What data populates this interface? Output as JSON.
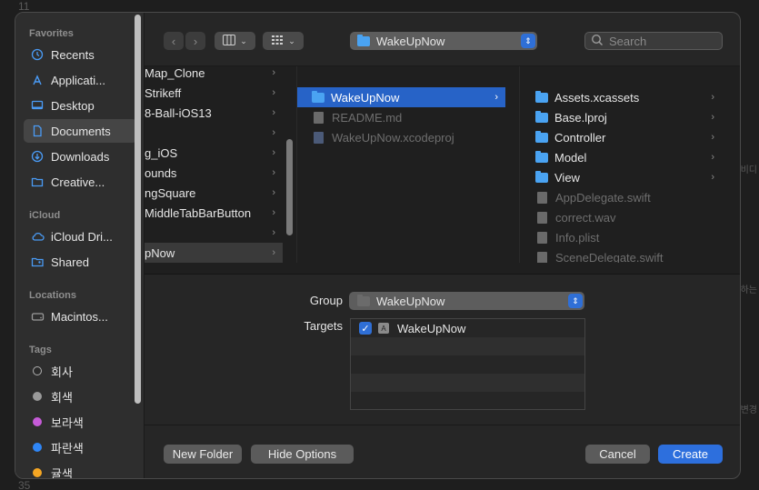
{
  "background": {
    "line_top": "11",
    "line_bottom": "35",
    "side_notes": [
      "비디",
      "하는",
      "변경"
    ]
  },
  "sidebar": {
    "sections": [
      {
        "title": "Favorites",
        "items": [
          {
            "label": "Recents",
            "icon": "clock-icon"
          },
          {
            "label": "Applicati...",
            "icon": "applications-icon"
          },
          {
            "label": "Desktop",
            "icon": "desktop-icon"
          },
          {
            "label": "Documents",
            "icon": "document-icon",
            "selected": true
          },
          {
            "label": "Downloads",
            "icon": "download-icon"
          },
          {
            "label": "Creative...",
            "icon": "folder-icon"
          }
        ]
      },
      {
        "title": "iCloud",
        "items": [
          {
            "label": "iCloud Dri...",
            "icon": "cloud-icon"
          },
          {
            "label": "Shared",
            "icon": "shared-folder-icon"
          }
        ]
      },
      {
        "title": "Locations",
        "items": [
          {
            "label": "Macintos...",
            "icon": "disk-icon"
          }
        ]
      },
      {
        "title": "Tags",
        "items": [
          {
            "label": "회사",
            "color": "#2a2a2a",
            "ring": "#b0b0b0"
          },
          {
            "label": "회색",
            "color": "#9a9a9a"
          },
          {
            "label": "보라색",
            "color": "#c65bd8"
          },
          {
            "label": "파란색",
            "color": "#2f86f6"
          },
          {
            "label": "귤색",
            "color": "#f5a623"
          }
        ]
      }
    ]
  },
  "toolbar": {
    "path": "WakeUpNow",
    "search_placeholder": "Search"
  },
  "browser": {
    "col1": [
      {
        "label": "Map_Clone",
        "selected": false
      },
      {
        "label": "Strikeff"
      },
      {
        "label": "8-Ball-iOS13"
      },
      {
        "label": ""
      },
      {
        "label": "g_iOS"
      },
      {
        "label": "ounds"
      },
      {
        "label": "ngSquare"
      },
      {
        "label": "MiddleTabBarButton"
      },
      {
        "label": ""
      },
      {
        "label": "pNow",
        "selected": true
      }
    ],
    "col2": [
      {
        "label": "WakeUpNow",
        "kind": "folder",
        "selected": true
      },
      {
        "label": "README.md",
        "kind": "file",
        "dim": true
      },
      {
        "label": "WakeUpNow.xcodeproj",
        "kind": "project",
        "dim": true
      }
    ],
    "col3": [
      {
        "label": "Assets.xcassets",
        "kind": "folder"
      },
      {
        "label": "Base.lproj",
        "kind": "folder"
      },
      {
        "label": "Controller",
        "kind": "folder"
      },
      {
        "label": "Model",
        "kind": "folder"
      },
      {
        "label": "View",
        "kind": "folder"
      },
      {
        "label": "AppDelegate.swift",
        "kind": "file",
        "dim": true
      },
      {
        "label": "correct.wav",
        "kind": "file",
        "dim": true
      },
      {
        "label": "Info.plist",
        "kind": "file",
        "dim": true
      },
      {
        "label": "SceneDelegate.swift",
        "kind": "file",
        "dim": true
      }
    ]
  },
  "options": {
    "group_label": "Group",
    "group_value": "WakeUpNow",
    "targets_label": "Targets",
    "targets": [
      {
        "label": "WakeUpNow",
        "checked": true
      }
    ]
  },
  "footer": {
    "new_folder": "New Folder",
    "hide_options": "Hide Options",
    "cancel": "Cancel",
    "create": "Create"
  },
  "colors": {
    "accent": "#2d6fdd",
    "selection": "#2763c7",
    "folder": "#4aa3f2"
  }
}
